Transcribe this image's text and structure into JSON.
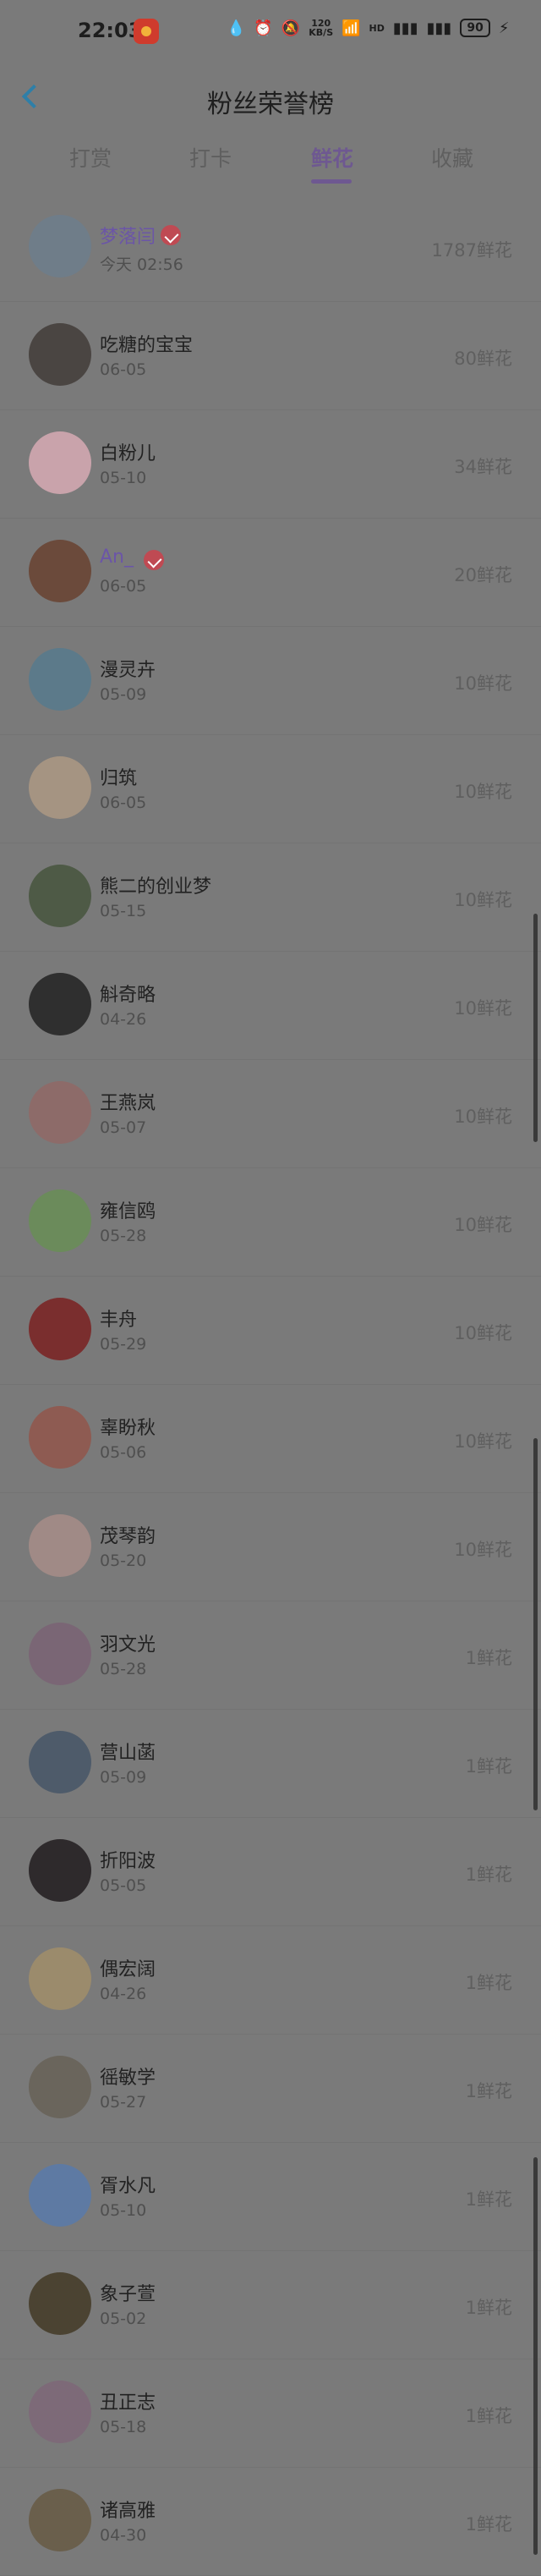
{
  "status_bar": {
    "time": "22:03",
    "speed": "120",
    "speed_unit": "KB/S",
    "hd_label": "HD",
    "battery": "90",
    "icons": [
      "water-drop-icon",
      "alarm-icon",
      "mute-icon",
      "wifi-icon",
      "signal-5g-icon",
      "signal-5g-icon",
      "charging-icon"
    ]
  },
  "header": {
    "title": "粉丝荣誉榜"
  },
  "tabs": [
    "打赏",
    "打卡",
    "鲜花",
    "收藏"
  ],
  "active_tab": "鲜花",
  "fans": [
    {
      "name": "梦落闫",
      "date": "今天 02:56",
      "amount": "1787鲜花",
      "vip": true
    },
    {
      "name": "吃糖的宝宝",
      "date": "06-05",
      "amount": "80鲜花"
    },
    {
      "name": "白粉儿",
      "date": "05-10",
      "amount": "34鲜花"
    },
    {
      "name": "An_",
      "date": "06-05",
      "amount": "20鲜花",
      "vip": true
    },
    {
      "name": "漫灵卉",
      "date": "05-09",
      "amount": "10鲜花"
    },
    {
      "name": "归筑",
      "date": "06-05",
      "amount": "10鲜花"
    },
    {
      "name": "熊二的创业梦",
      "date": "05-15",
      "amount": "10鲜花"
    },
    {
      "name": "斛奇略",
      "date": "04-26",
      "amount": "10鲜花"
    },
    {
      "name": "王燕岚",
      "date": "05-07",
      "amount": "10鲜花"
    },
    {
      "name": "雍信鸥",
      "date": "05-28",
      "amount": "10鲜花"
    },
    {
      "name": "丰舟",
      "date": "05-29",
      "amount": "10鲜花"
    },
    {
      "name": "辜盼秋",
      "date": "05-06",
      "amount": "10鲜花"
    },
    {
      "name": "茂琴韵",
      "date": "05-20",
      "amount": "10鲜花"
    },
    {
      "name": "羽文光",
      "date": "05-28",
      "amount": "1鲜花"
    },
    {
      "name": "营山菡",
      "date": "05-09",
      "amount": "1鲜花"
    },
    {
      "name": "折阳波",
      "date": "05-05",
      "amount": "1鲜花"
    },
    {
      "name": "偶宏阔",
      "date": "04-26",
      "amount": "1鲜花"
    },
    {
      "name": "徭敏学",
      "date": "05-27",
      "amount": "1鲜花"
    },
    {
      "name": "胥水凡",
      "date": "05-10",
      "amount": "1鲜花"
    },
    {
      "name": "象子萱",
      "date": "05-02",
      "amount": "1鲜花"
    },
    {
      "name": "丑正志",
      "date": "05-18",
      "amount": "1鲜花"
    },
    {
      "name": "诸高雅",
      "date": "04-30",
      "amount": "1鲜花"
    }
  ],
  "avatar_colors": [
    "#6f7d89",
    "#4a4542",
    "#c9a3ab",
    "#6b4a3b",
    "#5c7a8a",
    "#a59482",
    "#4e5a46",
    "#2f2f2f",
    "#8d6b69",
    "#6b8b5b",
    "#7a2e2e",
    "#8e5b52",
    "#a08a86",
    "#7a6675",
    "#4e5b6a",
    "#2e2a2c",
    "#9b8b6c",
    "#6a655c",
    "#5e7aa3",
    "#4b4332",
    "#7d6a78",
    "#6a5f4c"
  ],
  "colors": {
    "accent": "#6e5891",
    "background": "#7a7a7a",
    "back_arrow": "#2e7fa8",
    "vip_badge": "#bf4a53"
  }
}
